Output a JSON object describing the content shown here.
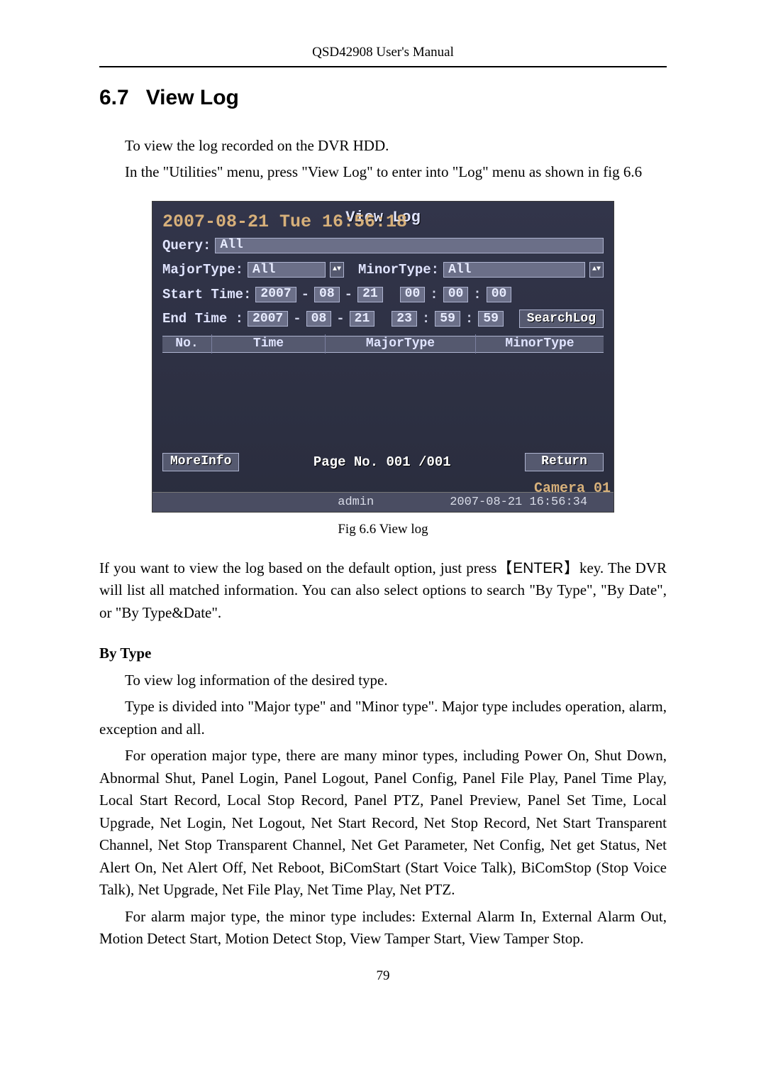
{
  "header": "QSD42908 User's Manual",
  "section": {
    "number": "6.7",
    "title": "View Log"
  },
  "intro1": "To view the log recorded on the DVR HDD.",
  "intro2": "In the \"Utilities\" menu, press \"View Log\" to enter into \"Log\" menu as shown in fig 6.6",
  "fig": {
    "title": "View Log",
    "osd_datetime": "2007-08-21 Tue 16:56:18",
    "query_label": "Query:",
    "query_value": "All",
    "major_label": "MajorType:",
    "major_value": "All",
    "minor_label": "MinorType:",
    "minor_value": "All",
    "start_label": "Start Time:",
    "end_label": "End Time  :",
    "start": {
      "y": "2007",
      "m": "08",
      "d": "21",
      "hh": "00",
      "mm": "00",
      "ss": "00"
    },
    "end": {
      "y": "2007",
      "m": "08",
      "d": "21",
      "hh": "23",
      "mm": "59",
      "ss": "59"
    },
    "search_btn": "SearchLog",
    "th": {
      "no": "No.",
      "time": "Time",
      "major": "MajorType",
      "minor": "MinorType"
    },
    "moreinfo_btn": "MoreInfo",
    "page_label": "Page No. 001 /001",
    "return_btn": "Return",
    "status_user": "admin",
    "status_time": "2007-08-21 16:56:34",
    "osd_camera": "Camera 01"
  },
  "fig_caption": "Fig 6.6 View log",
  "para1a": "If you want to view the log based on the default option, just press",
  "para1_key": "【ENTER】",
  "para1b": "key. The DVR will list all matched information. You can also select options to search \"By Type\", \"By Date\", or \"By Type&Date\".",
  "bytype_heading": "By Type",
  "bt_p1": "To view log information of the desired type.",
  "bt_p2": "Type is divided into \"Major type\" and \"Minor type\". Major type includes operation, alarm, exception and all.",
  "bt_p3": "For operation major type, there are many minor types, including Power On, Shut Down, Abnormal Shut, Panel Login, Panel Logout, Panel Config, Panel File Play, Panel Time Play, Local Start Record, Local Stop Record, Panel PTZ, Panel Preview, Panel Set Time, Local Upgrade, Net Login, Net Logout, Net Start Record, Net Stop Record, Net Start Transparent Channel, Net Stop Transparent Channel, Net Get Parameter, Net Config, Net get Status, Net Alert On, Net Alert Off, Net Reboot, BiComStart (Start Voice Talk), BiComStop (Stop Voice Talk), Net Upgrade, Net File Play, Net Time Play, Net PTZ.",
  "bt_p4": "For alarm major type, the minor type includes: External Alarm In, External Alarm Out, Motion Detect Start, Motion Detect Stop, View Tamper Start, View Tamper Stop.",
  "pagenum": "79"
}
